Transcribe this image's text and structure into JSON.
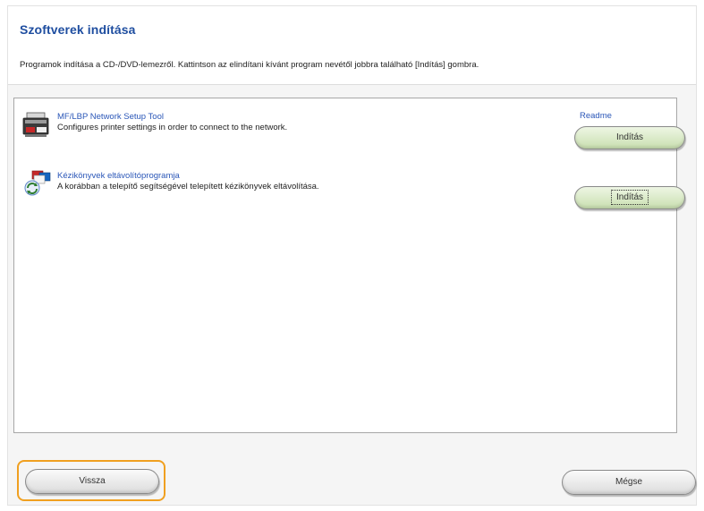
{
  "header": {
    "title": "Szoftverek indítása",
    "description": "Programok indítása a CD-/DVD-lemezről. Kattintson az elindítani kívánt program nevétől jobbra található [Indítás] gombra."
  },
  "programs": [
    {
      "name": "MF/LBP Network Setup Tool",
      "description": "Configures printer settings in order to connect to the network.",
      "readme": "Readme",
      "launch_label": "Indítás",
      "icon": "printer-icon"
    },
    {
      "name": "Kézikönyvek eltávolítóprogramja",
      "description": "A korábban a telepítő segítségével telepített kézikönyvek eltávolítása.",
      "launch_label": "Indítás",
      "icon": "uninstall-manuals-icon"
    }
  ],
  "footer": {
    "back_label": "Vissza",
    "cancel_label": "Mégse"
  },
  "colors": {
    "title": "#1f4ea0",
    "link": "#2b57b8",
    "launch_button": "#c9dfb0",
    "focus_highlight": "#f0a020"
  }
}
